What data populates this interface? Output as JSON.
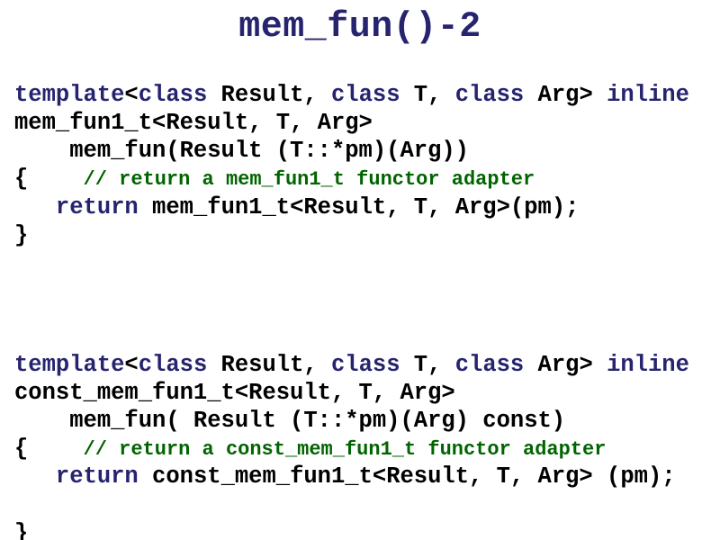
{
  "title": "mem_fun()-2",
  "block1": {
    "l1a": "template",
    "l1b": "<",
    "l1c": "class",
    "l1d": " Result, ",
    "l1e": "class",
    "l1f": " T, ",
    "l1g": "class",
    "l1h": " Arg> ",
    "l1i": "inline",
    "l2": "mem_fun1_t<Result, T, Arg>",
    "l3": "    mem_fun(Result (T::*pm)(Arg))",
    "l4o": "{    ",
    "l4c": "// return a mem_fun1_t functor adapter",
    "l5a": "   ",
    "l5b": "return",
    "l5c": " mem_fun1_t<Result, T, Arg>(pm);",
    "l6": "}"
  },
  "block2": {
    "l1a": "template",
    "l1b": "<",
    "l1c": "class",
    "l1d": " Result, ",
    "l1e": "class",
    "l1f": " T, ",
    "l1g": "class",
    "l1h": " Arg> ",
    "l1i": "inline",
    "l2": "const_mem_fun1_t<Result, T, Arg>",
    "l3": "    mem_fun( Result (T::*pm)(Arg) const)",
    "l4o": "{    ",
    "l4c": "// return a const_mem_fun1_t functor adapter",
    "l5a": "   ",
    "l5b": "return",
    "l5c": " const_mem_fun1_t<Result, T, Arg> (pm);",
    "l6": "}"
  }
}
